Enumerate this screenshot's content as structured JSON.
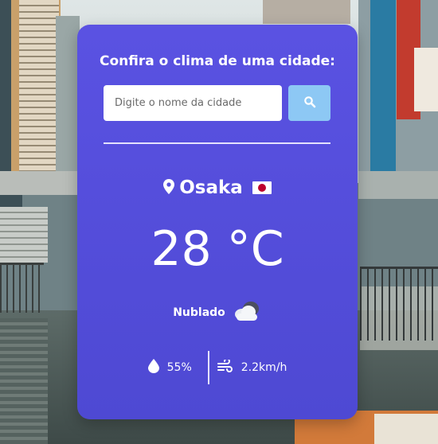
{
  "search": {
    "heading": "Confira o clima de uma cidade:",
    "placeholder": "Digite o nome da cidade",
    "button_icon": "search-icon"
  },
  "weather": {
    "city": "Osaka",
    "country_flag": "flag-japan-icon",
    "temperature": "28 °C",
    "condition": "Nublado",
    "condition_icon": "cloud-icon",
    "humidity": "55%",
    "wind": "2.2km/h"
  },
  "colors": {
    "card": "#5a52e2",
    "search_button": "#8dc8f4",
    "text": "#ffffff"
  }
}
